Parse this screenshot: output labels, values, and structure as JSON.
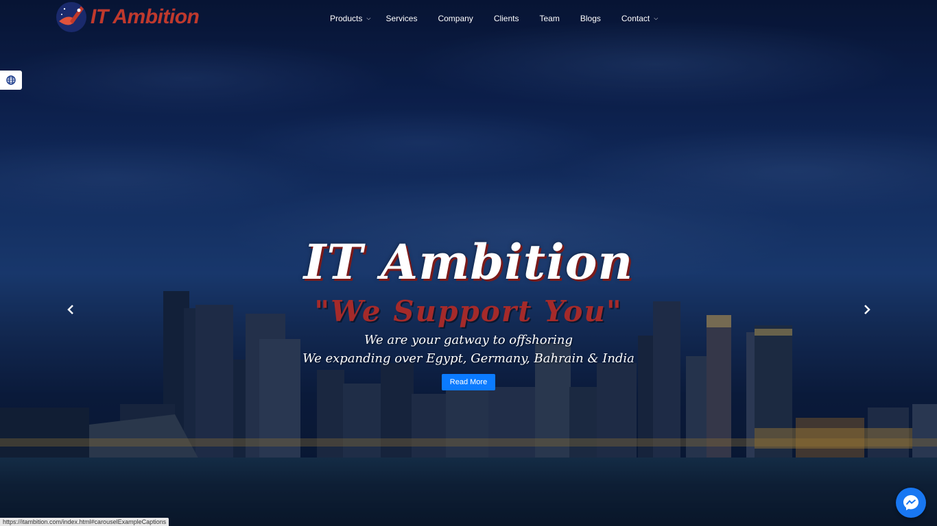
{
  "brand": {
    "name": "IT Ambition",
    "logo_colors": {
      "primary": "#c0392b",
      "secondary": "#1a2a6c"
    }
  },
  "nav": {
    "items": [
      {
        "label": "Products",
        "has_caret": true
      },
      {
        "label": "Services",
        "has_caret": false
      },
      {
        "label": "Company",
        "has_caret": false
      },
      {
        "label": "Clients",
        "has_caret": false
      },
      {
        "label": "Team",
        "has_caret": false
      },
      {
        "label": "Blogs",
        "has_caret": false
      },
      {
        "label": "Contact",
        "has_caret": true
      }
    ]
  },
  "language": {
    "icon": "globe-icon"
  },
  "hero": {
    "title": "IT Ambition",
    "slogan": "\"We Support You\"",
    "line1": "We are your gatway to offshoring",
    "line2": "We expanding over Egypt, Germany, Bahrain & India",
    "cta_label": "Read More"
  },
  "carousel": {
    "prev_icon": "chevron-left-icon",
    "next_icon": "chevron-right-icon"
  },
  "messenger": {
    "icon": "messenger-icon"
  },
  "status_bar": {
    "url": "https://itambition.com/index.html#carouselExampleCaptions"
  },
  "colors": {
    "accent": "#0b7bff",
    "slogan": "#a52a2a",
    "messenger": "#1877f2"
  }
}
